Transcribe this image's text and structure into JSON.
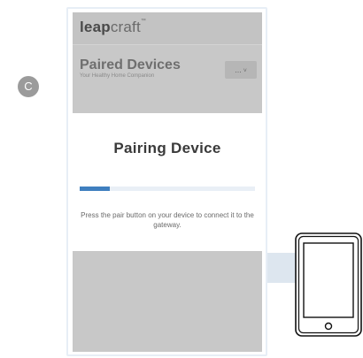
{
  "step": {
    "letter": "C"
  },
  "app": {
    "brand_bold": "leap",
    "brand_light": "craft",
    "brand_tm": "™",
    "page_title": "Paired Devices",
    "page_subtitle": "Your Healthy Home Companion",
    "more_label": "...",
    "more_chevron": "˅"
  },
  "modal": {
    "title": "Pairing Device",
    "progress": 0.17,
    "message": "Press the pair button on your device to connect it to the gateway."
  },
  "colors": {
    "progress_fill": "#3f7fbf",
    "progress_track": "#e9eff6",
    "overlay_dim": "#c8c8c8",
    "callout": "#dde6ef"
  },
  "icons": {
    "device": "tablet-icon"
  }
}
